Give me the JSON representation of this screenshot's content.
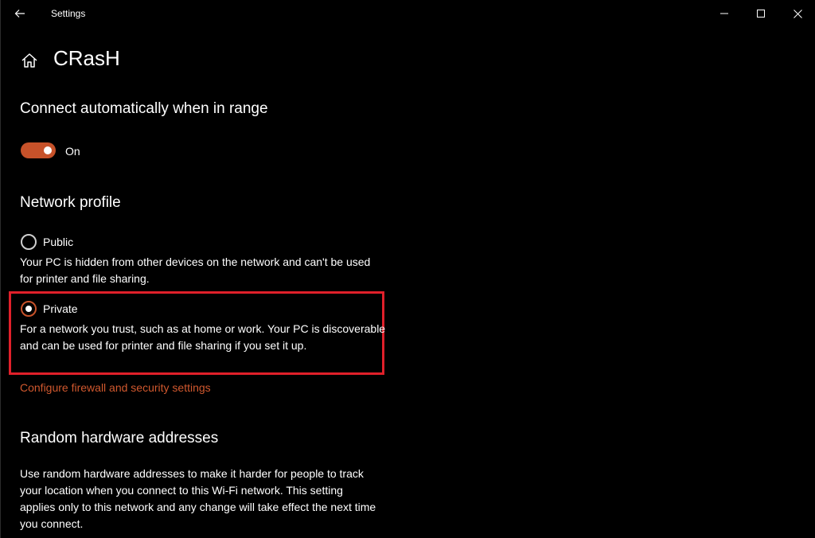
{
  "window": {
    "title": "Settings"
  },
  "header": {
    "title": "CRasH"
  },
  "connect": {
    "heading": "Connect automatically when in range",
    "toggle_state": "On",
    "accent_color": "#c7522a"
  },
  "profile": {
    "heading": "Network profile",
    "options": [
      {
        "label": "Public",
        "selected": false,
        "description": "Your PC is hidden from other devices on the network and can't be used for printer and file sharing."
      },
      {
        "label": "Private",
        "selected": true,
        "description": "For a network you trust, such as at home or work. Your PC is discoverable and can be used for printer and file sharing if you set it up."
      }
    ],
    "link": "Configure firewall and security settings",
    "highlight_color": "#e0202a"
  },
  "random": {
    "heading": "Random hardware addresses",
    "description": "Use random hardware addresses to make it harder for people to track your location when you connect to this Wi-Fi network. This setting applies only to this network and any change will take effect the next time you connect."
  },
  "icons": {
    "back": "back-arrow-icon",
    "home": "home-icon",
    "minimize": "minimize-icon",
    "maximize": "maximize-icon",
    "close": "close-icon"
  }
}
